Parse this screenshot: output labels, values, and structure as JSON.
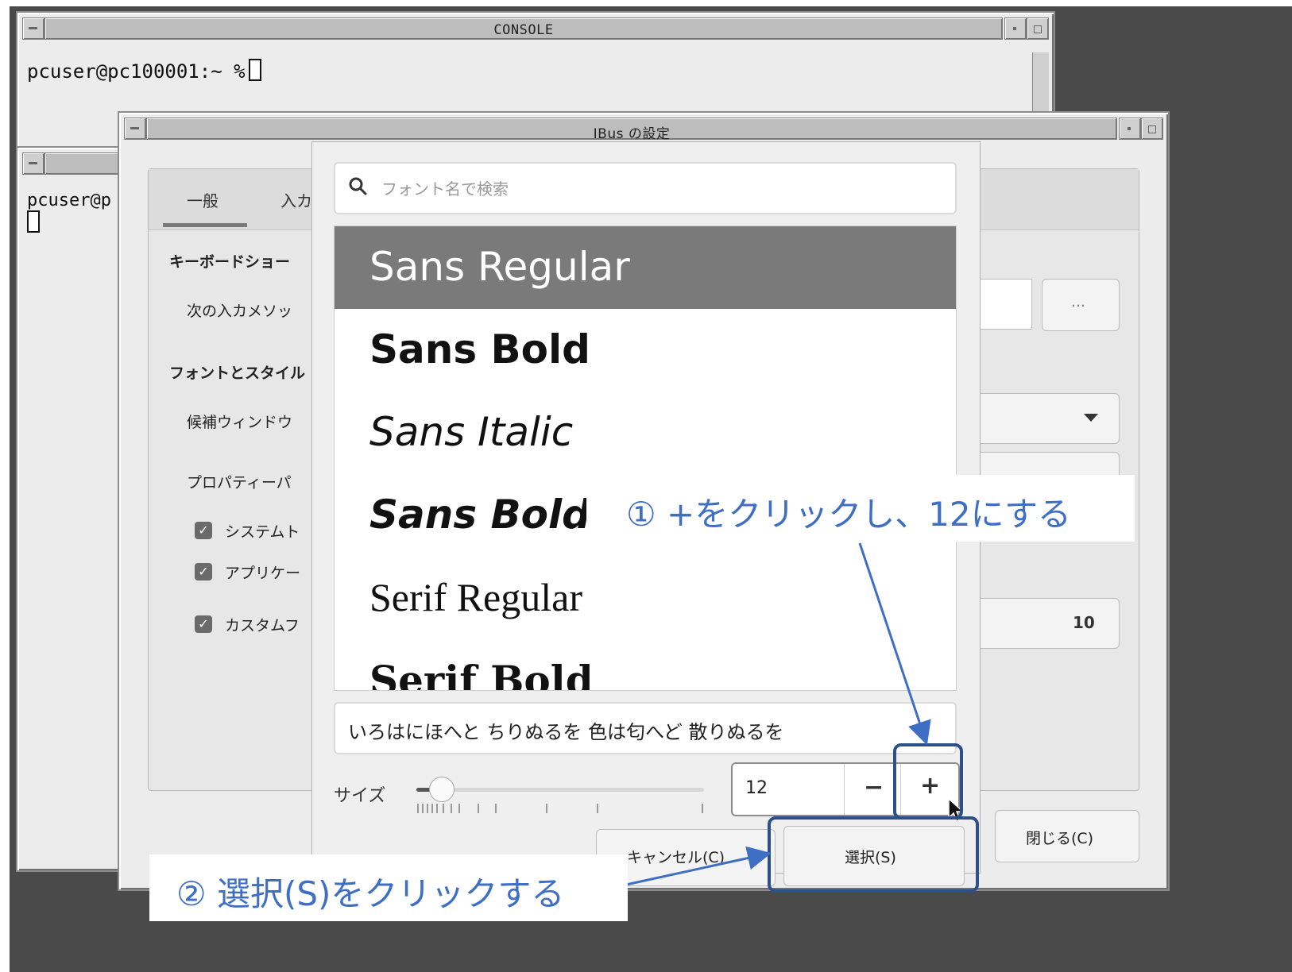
{
  "console_window": {
    "title": "CONSOLE",
    "prompt": "pcuser@pc100001:~ %"
  },
  "second_terminal": {
    "prompt": "pcuser@p"
  },
  "ibus_window": {
    "title": "IBus の設定",
    "tabs": [
      "一般",
      "入カ"
    ],
    "keyboard_section": "キーボードショー",
    "next_input_method": "次の入カメソッ",
    "more_button": "…",
    "font_section": "フォントとスタイル",
    "candidate_window": "候補ウィンドウ",
    "property_panel": "プロパティーパ",
    "checkboxes": [
      "システムト",
      "アプリケー",
      "カスタムフ"
    ],
    "font_size_value": "10",
    "close_button": "閉じる(C)"
  },
  "font_dialog": {
    "search_placeholder": "フォント名で検索",
    "fonts": [
      "Sans Regular",
      "Sans Bold",
      "Sans Italic",
      "Sans Bold",
      "Serif Regular",
      "Serif Bold"
    ],
    "selected_font": "Sans Regular",
    "preview_text": "いろはにほへと ちりぬるを 色は匂へど 散りぬるを",
    "size_label": "サイズ",
    "size_value": "12",
    "minus_label": "−",
    "plus_label": "+",
    "cancel_button": "キャンセル(C)",
    "select_button": "選択(S)"
  },
  "annotations": {
    "step1": "① +をクリックし、12にする",
    "step2": "② 選択(S)をクリックする"
  },
  "colors": {
    "annotation_text": "#3f6fc4",
    "annotation_box": "#2d4f8a",
    "selected_row": "#7a7a7a"
  }
}
